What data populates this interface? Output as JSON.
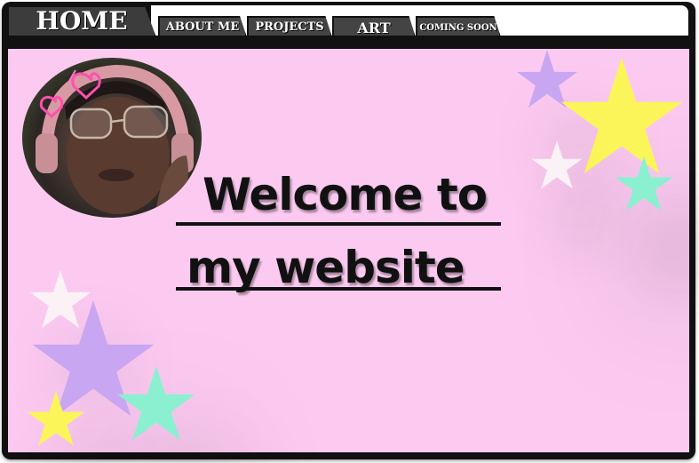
{
  "nav": {
    "home": "HOME",
    "about": "ABOUT ME",
    "projects": "PROJECTS",
    "art": "ART",
    "coming_soon": "COMING SOON"
  },
  "hero": {
    "line1": "Welcome to",
    "line2": "my website"
  },
  "colors": {
    "background": "#fccaf1",
    "frame": "#111111",
    "tab": "#444444",
    "star_purple": "#c9a6f2",
    "star_yellow": "#fbf55a",
    "star_mint": "#8af0d0",
    "star_white": "#fbf2f5"
  },
  "icons": [
    "profile-photo",
    "heart-stickers",
    "decorative-stars"
  ]
}
